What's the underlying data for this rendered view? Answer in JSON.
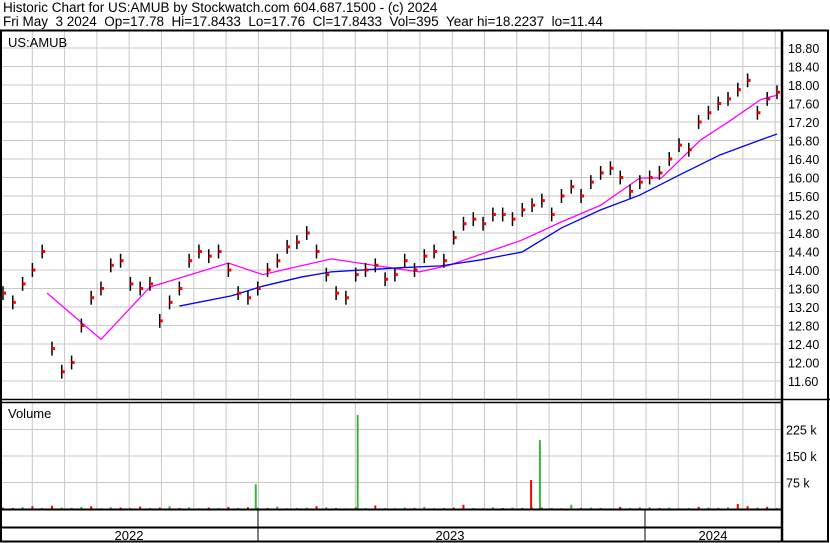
{
  "header": {
    "title": "Historic Chart for US:AMUB by Stockwatch.com 604.687.1500 - (c) 2024",
    "quote_line": "Fri May  3 2024  Op=17.78  Hi=17.8433  Lo=17.76  Cl=17.8433  Vol=395  Year hi=18.2237  lo=11.44"
  },
  "colors": {
    "bar": "#000000",
    "close_dot": "#ff0000",
    "ma_short": "#ff00ff",
    "ma_long": "#0000ff",
    "vol_up": "#3cb43c",
    "vol_down": "#ff0000",
    "grid": "#c8c8c8"
  },
  "chart_data": [
    {
      "type": "line",
      "title": "US:AMUB",
      "y_ticks": [
        "18.80",
        "18.40",
        "18.00",
        "17.60",
        "17.20",
        "16.80",
        "16.40",
        "16.00",
        "15.60",
        "15.20",
        "14.80",
        "14.40",
        "14.00",
        "13.60",
        "13.20",
        "12.80",
        "12.40",
        "12.00",
        "11.60"
      ],
      "ylim": [
        11.2,
        19.0
      ],
      "x_index_range": [
        0,
        79
      ],
      "closes": [
        13.5,
        13.3,
        13.7,
        14.0,
        14.4,
        12.3,
        11.8,
        12.0,
        12.8,
        13.4,
        13.6,
        14.1,
        14.2,
        13.7,
        13.6,
        13.7,
        12.9,
        13.3,
        13.6,
        14.2,
        14.4,
        14.3,
        14.4,
        14.0,
        13.5,
        13.4,
        13.6,
        14.0,
        14.2,
        14.5,
        14.6,
        14.8,
        14.4,
        13.9,
        13.5,
        13.4,
        13.9,
        14.0,
        14.1,
        13.8,
        13.9,
        14.2,
        14.0,
        14.3,
        14.4,
        14.2,
        14.7,
        15.0,
        15.1,
        15.0,
        15.2,
        15.2,
        15.1,
        15.3,
        15.4,
        15.5,
        15.2,
        15.6,
        15.8,
        15.6,
        15.9,
        16.1,
        16.2,
        16.0,
        15.7,
        15.9,
        16.0,
        16.1,
        16.4,
        16.7,
        16.6,
        17.2,
        17.4,
        17.6,
        17.7,
        17.9,
        18.1,
        17.4,
        17.7,
        17.8433
      ],
      "series": [
        {
          "name": "short moving average",
          "points": [
            [
              4.5,
              13.5
            ],
            [
              10,
              12.5
            ],
            [
              15,
              13.63
            ],
            [
              23,
              14.15
            ],
            [
              26.5,
              13.9
            ],
            [
              33.5,
              14.24
            ],
            [
              39.5,
              14.05
            ],
            [
              42.5,
              13.96
            ],
            [
              45.5,
              14.1
            ],
            [
              53,
              14.65
            ],
            [
              57,
              15.04
            ],
            [
              61,
              15.4
            ],
            [
              65,
              15.99
            ],
            [
              67.2,
              15.99
            ],
            [
              71.2,
              16.81
            ],
            [
              74.3,
              17.24
            ],
            [
              77.3,
              17.68
            ],
            [
              79,
              17.78
            ]
          ]
        },
        {
          "name": "long moving average",
          "points": [
            [
              18,
              13.22
            ],
            [
              23.3,
              13.44
            ],
            [
              26.5,
              13.65
            ],
            [
              30.5,
              13.85
            ],
            [
              33.5,
              13.96
            ],
            [
              40.6,
              14.05
            ],
            [
              44.7,
              14.09
            ],
            [
              48.8,
              14.22
            ],
            [
              53,
              14.39
            ],
            [
              57,
              14.91
            ],
            [
              61,
              15.3
            ],
            [
              65,
              15.62
            ],
            [
              69.1,
              16.06
            ],
            [
              73.2,
              16.49
            ],
            [
              77.3,
              16.81
            ],
            [
              79,
              16.94
            ]
          ]
        }
      ]
    },
    {
      "type": "bar",
      "title": "Volume",
      "y_ticks": [
        "225 k",
        "150 k",
        "75 k"
      ],
      "ylim": [
        0,
        300000
      ],
      "small_volumes": [
        4000,
        3000,
        5000,
        8000,
        3000,
        9000,
        4000,
        3000,
        6000,
        8000,
        2000,
        5000,
        4000,
        3000,
        7000,
        3000,
        4000,
        8000,
        3000,
        5000,
        2000,
        4000,
        3000,
        6000,
        3000,
        5000,
        4000,
        3000,
        7000,
        2000,
        3000,
        4000,
        8000,
        5000,
        3000,
        2000,
        4000,
        3000,
        10000,
        3000,
        2000,
        4000,
        3000,
        6000,
        2000,
        3000,
        4000,
        12000,
        3000,
        2000,
        5000,
        3000,
        4000,
        3000,
        5000,
        4000,
        3000,
        2000,
        12000,
        3000,
        4000,
        3000,
        2000,
        6000,
        3000,
        4000,
        5000,
        3000,
        4000,
        2000,
        3000,
        6000,
        4000,
        3000,
        5000,
        14000,
        8000,
        4000,
        6000,
        3000
      ],
      "small_colors": [
        "down",
        "down",
        "up",
        "down",
        "up",
        "down",
        "up",
        "down",
        "up",
        "down",
        "up",
        "up",
        "down",
        "up",
        "down",
        "up",
        "down",
        "up",
        "down",
        "up",
        "down",
        "down",
        "up",
        "down",
        "up",
        "down",
        "up",
        "down",
        "up",
        "down",
        "up",
        "up",
        "down",
        "up",
        "down",
        "up",
        "down",
        "up",
        "down",
        "up",
        "down",
        "up",
        "down",
        "up",
        "down",
        "up",
        "down",
        "down",
        "up",
        "down",
        "up",
        "down",
        "up",
        "down",
        "up",
        "down",
        "up",
        "down",
        "up",
        "down",
        "up",
        "down",
        "up",
        "down",
        "up",
        "down",
        "up",
        "down",
        "up",
        "down",
        "up",
        "down",
        "up",
        "down",
        "up",
        "down",
        "down",
        "up",
        "down",
        "up"
      ],
      "spikes": [
        {
          "index": 25.8,
          "volume": 70000,
          "dir": "up"
        },
        {
          "index": 36.2,
          "volume": 266000,
          "dir": "up"
        },
        {
          "index": 53.9,
          "volume": 82000,
          "dir": "down"
        },
        {
          "index": 54.8,
          "volume": 195000,
          "dir": "up"
        }
      ],
      "x_labels": [
        "2022",
        "2023",
        "2024"
      ]
    }
  ]
}
